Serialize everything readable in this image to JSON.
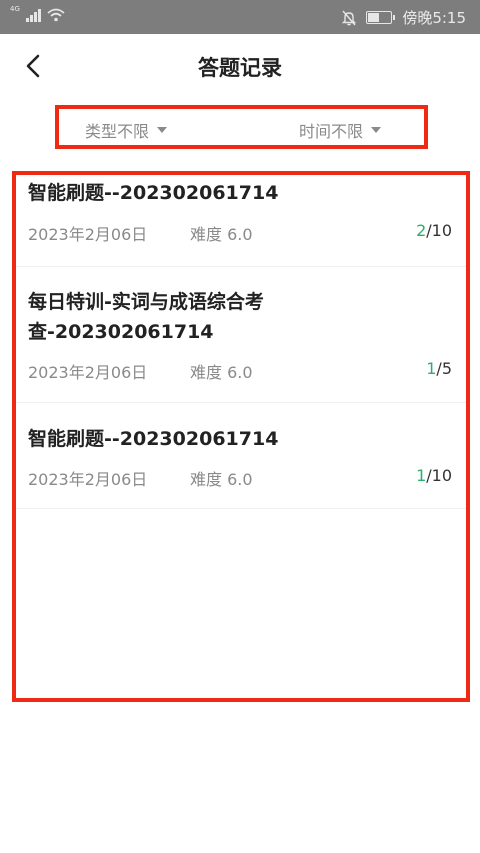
{
  "status_bar": {
    "network": "4G",
    "time_label": "傍晚5:15"
  },
  "header": {
    "title": "答题记录"
  },
  "filters": {
    "type_label": "类型不限",
    "time_label": "时间不限"
  },
  "records": [
    {
      "title_line1": "智能刷题--202302061714",
      "title_line2": "",
      "date": "2023年2月06日",
      "difficulty": "难度 6.0",
      "correct": "2",
      "total": "/10"
    },
    {
      "title_line1": "每日特训-实词与成语综合考",
      "title_line2": "查-202302061714",
      "date": "2023年2月06日",
      "difficulty": "难度 6.0",
      "correct": "1",
      "total": "/5"
    },
    {
      "title_line1": "智能刷题--202302061714",
      "title_line2": "",
      "date": "2023年2月06日",
      "difficulty": "难度 6.0",
      "correct": "1",
      "total": "/10"
    }
  ],
  "colors": {
    "accent_green": "#2bb06a",
    "highlight_red": "#ee2a14"
  }
}
